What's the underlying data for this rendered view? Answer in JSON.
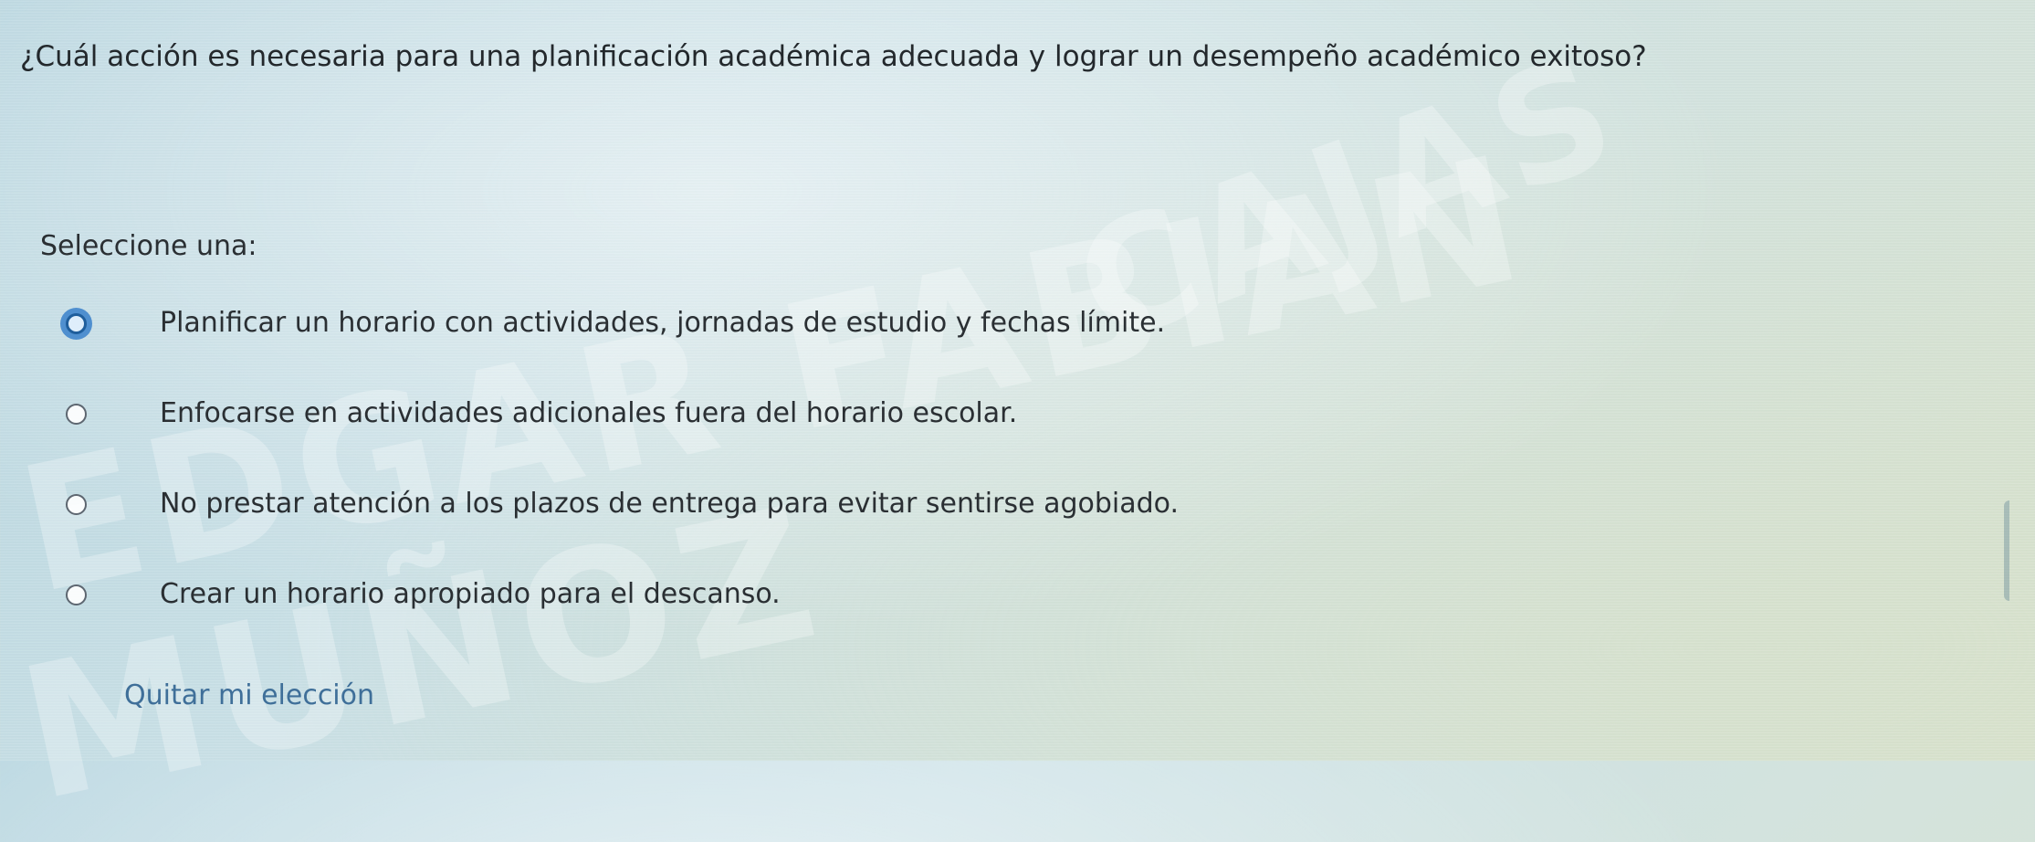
{
  "question": {
    "text": "¿Cuál acción es necesaria para una planificación académica adecuada y lograr un desempeño académico exitoso?"
  },
  "select_label": "Seleccione una:",
  "options": [
    {
      "label": "Planificar un horario con actividades, jornadas de estudio y fechas límite.",
      "selected": true
    },
    {
      "label": "Enfocarse en actividades adicionales fuera del horario escolar.",
      "selected": false
    },
    {
      "label": "No prestar atención a los plazos de entrega para evitar sentirse agobiado.",
      "selected": false
    },
    {
      "label": "Crear un horario apropiado para el descanso.",
      "selected": false
    }
  ],
  "clear_choice": "Quitar mi elección",
  "watermark": {
    "line1": "CAJAS",
    "line2": "EDGAR FABIAN",
    "line3": "MUÑOZ"
  },
  "colors": {
    "selected_radio": "#4f8fcf",
    "link": "#3f6f99"
  }
}
